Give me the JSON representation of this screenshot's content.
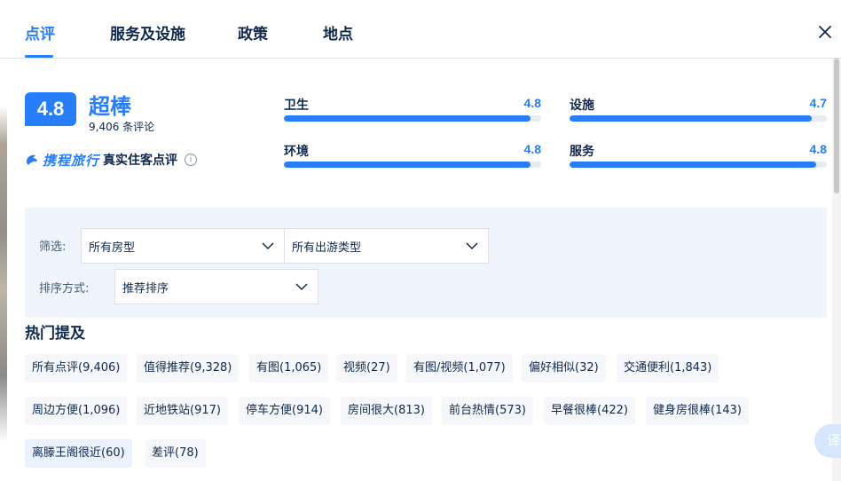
{
  "tabs": [
    {
      "label": "点评",
      "active": true
    },
    {
      "label": "服务及设施",
      "active": false
    },
    {
      "label": "政策",
      "active": false
    },
    {
      "label": "地点",
      "active": false
    }
  ],
  "summary": {
    "score": "4.8",
    "score_word": "超棒",
    "review_count": "9,406 条评论",
    "brand_logo": "携程旅行",
    "brand_text": "真实住客点评"
  },
  "ratings": [
    {
      "label": "卫生",
      "value": "4.8",
      "fraction": 0.96
    },
    {
      "label": "设施",
      "value": "4.7",
      "fraction": 0.94
    },
    {
      "label": "环境",
      "value": "4.8",
      "fraction": 0.96
    },
    {
      "label": "服务",
      "value": "4.8",
      "fraction": 0.96
    }
  ],
  "filters": {
    "filter_label": "筛选:",
    "room_type": "所有房型",
    "trip_type": "所有出游类型",
    "sort_label": "排序方式:",
    "sort_value": "推荐排序"
  },
  "hot": {
    "title": "热门提及",
    "tags": [
      "所有点评(9,406)",
      "值得推荐(9,328)",
      "有图(1,065)",
      "视频(27)",
      "有图/视频(1,077)",
      "偏好相似(32)",
      "交通便利(1,843)",
      "周边方便(1,096)",
      "近地铁站(917)",
      "停车方便(914)",
      "房间很大(813)",
      "前台热情(573)",
      "早餐很棒(422)",
      "健身房很棒(143)",
      "离滕王阁很近(60)",
      "差评(78)"
    ]
  },
  "translate_label": "译",
  "colors": {
    "accent": "#287dfa",
    "text": "#0f294d",
    "panel": "#f0f5fd"
  }
}
